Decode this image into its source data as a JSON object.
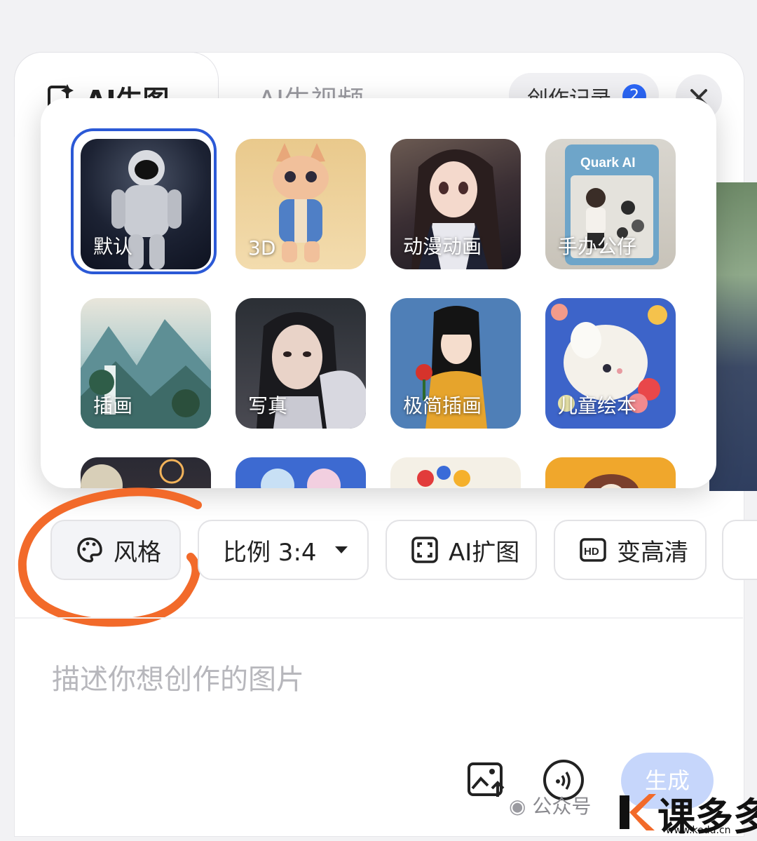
{
  "tabs": [
    {
      "label": "AI生图"
    },
    {
      "label": "AI生视频"
    }
  ],
  "history": {
    "label": "创作记录",
    "badge": "2"
  },
  "styles": [
    {
      "label": "默认",
      "selected": true
    },
    {
      "label": "3D"
    },
    {
      "label": "动漫动画"
    },
    {
      "label": "手办公仔"
    },
    {
      "label": "插画"
    },
    {
      "label": "写真"
    },
    {
      "label": "极简插画"
    },
    {
      "label": "儿童绘本"
    }
  ],
  "style_tile_texts": {
    "quark_box": "Quark AI"
  },
  "toolbar": {
    "style": "风格",
    "ratio": "比例 3:4",
    "expand": "AI扩图",
    "hd": "变高清",
    "hd_icon_text": "HD"
  },
  "prompt": {
    "placeholder": "描述你想创作的图片"
  },
  "generate": {
    "label": "生成"
  },
  "watermark": {
    "text": "公众号"
  },
  "logo": {
    "text": "课多多",
    "url": "www.kedd.cn"
  },
  "colors": {
    "accent": "#2b66f6",
    "selected_ring": "#2b59d6",
    "annotation": "#f26a2a"
  }
}
